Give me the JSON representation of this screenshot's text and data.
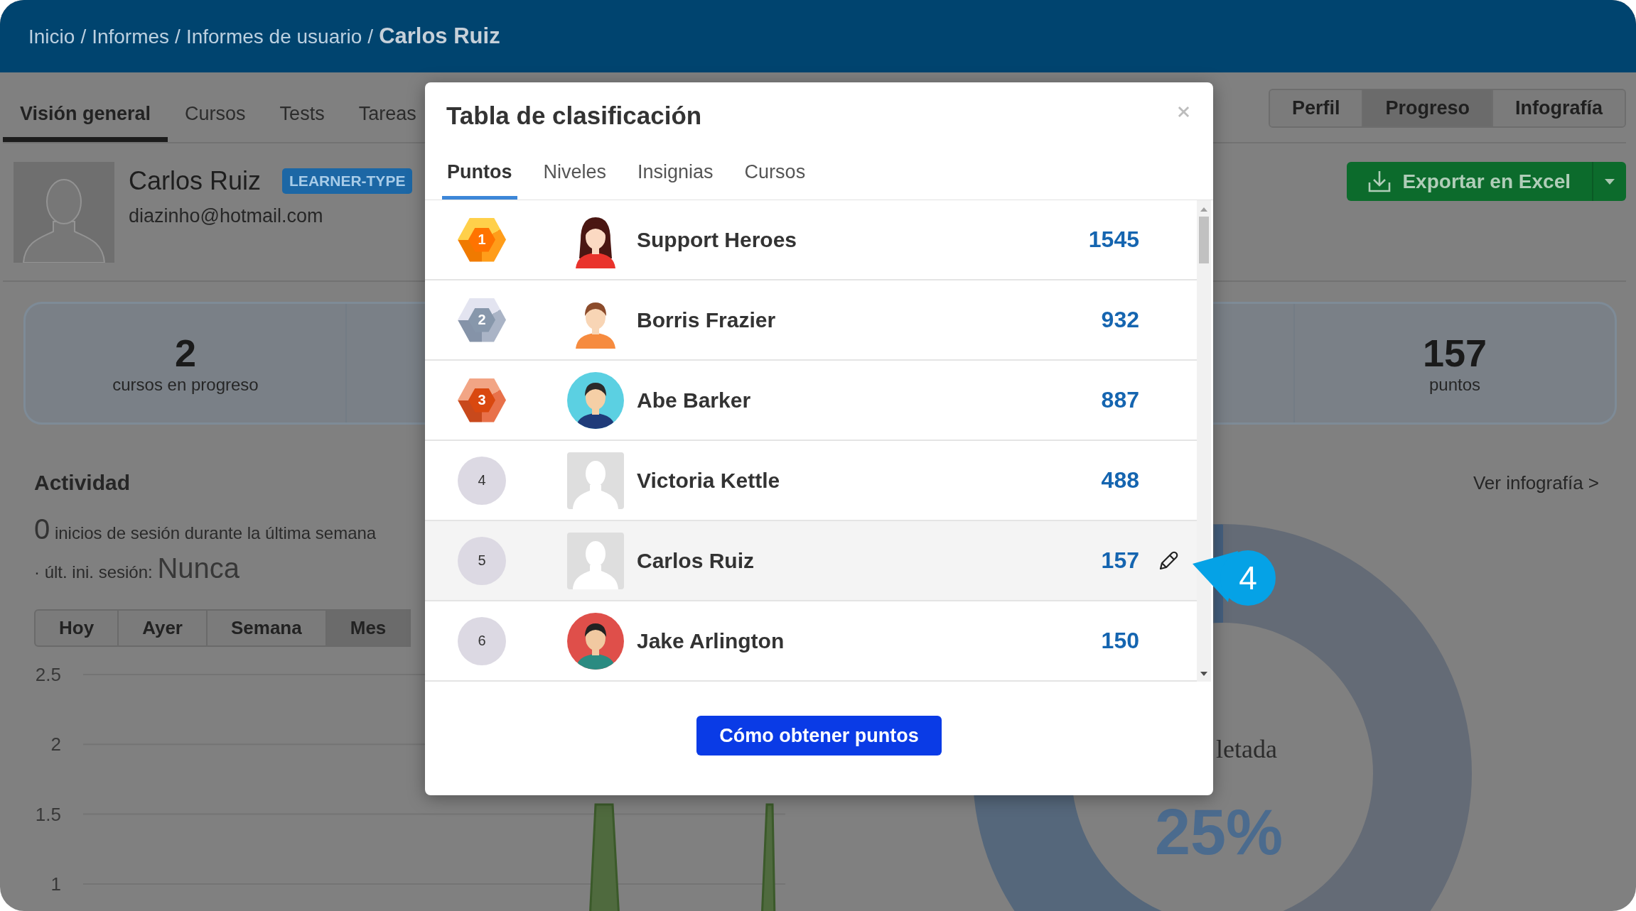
{
  "breadcrumb": {
    "items": [
      "Inicio",
      "Informes",
      "Informes de usuario"
    ],
    "separator": "/",
    "current": "Carlos Ruiz"
  },
  "nav_tabs": [
    {
      "label": "Visión general",
      "selected": true
    },
    {
      "label": "Cursos",
      "selected": false
    },
    {
      "label": "Tests",
      "selected": false
    },
    {
      "label": "Tareas",
      "selected": false
    }
  ],
  "view_switch": [
    {
      "label": "Perfil",
      "selected": false
    },
    {
      "label": "Progreso",
      "selected": true
    },
    {
      "label": "Infografía",
      "selected": false
    }
  ],
  "profile": {
    "name": "Carlos Ruiz",
    "badge": "LEARNER-TYPE",
    "email": "diazinho@hotmail.com"
  },
  "export_button": {
    "label": "Exportar en Excel"
  },
  "stats": [
    {
      "value": "2",
      "label": "cursos en progreso"
    },
    {
      "value": "157",
      "label": "puntos"
    }
  ],
  "activity": {
    "title": "Actividad",
    "logins_count": "0",
    "logins_text": "inicios de sesión durante la última semana",
    "last_login_label": "· últ. ini. sesión:",
    "last_login_value": "Nunca",
    "periods": [
      {
        "label": "Hoy",
        "selected": false
      },
      {
        "label": "Ayer",
        "selected": false
      },
      {
        "label": "Semana",
        "selected": false
      },
      {
        "label": "Mes",
        "selected": true
      }
    ],
    "chart": {
      "y_labels": [
        "2.5",
        "2",
        "1.5",
        "1"
      ]
    }
  },
  "infographic_link": "Ver infografía >",
  "completion": {
    "label": "letada",
    "value": "25%"
  },
  "leaderboard": {
    "title": "Tabla de clasificación",
    "tabs": [
      {
        "label": "Puntos",
        "selected": true
      },
      {
        "label": "Niveles",
        "selected": false
      },
      {
        "label": "Insignias",
        "selected": false
      },
      {
        "label": "Cursos",
        "selected": false
      }
    ],
    "rows": [
      {
        "rank": {
          "label": "1",
          "kind": "gold"
        },
        "avatar": {
          "kind": "illustration"
        },
        "name": "Support Heroes",
        "points": "1545",
        "current_user": false
      },
      {
        "rank": {
          "label": "2",
          "kind": "silver"
        },
        "avatar": {
          "kind": "illustration"
        },
        "name": "Borris Frazier",
        "points": "932",
        "current_user": false
      },
      {
        "rank": {
          "label": "3",
          "kind": "bronze"
        },
        "avatar": {
          "kind": "illustration"
        },
        "name": "Abe Barker",
        "points": "887",
        "current_user": false
      },
      {
        "rank": {
          "label": "4",
          "kind": "plain"
        },
        "avatar": {
          "kind": "placeholder"
        },
        "name": "Victoria Kettle",
        "points": "488",
        "current_user": false
      },
      {
        "rank": {
          "label": "5",
          "kind": "plain"
        },
        "avatar": {
          "kind": "placeholder"
        },
        "name": "Carlos Ruiz",
        "points": "157",
        "current_user": true
      },
      {
        "rank": {
          "label": "6",
          "kind": "plain"
        },
        "avatar": {
          "kind": "illustration"
        },
        "name": "Jake Arlington",
        "points": "150",
        "current_user": false
      }
    ],
    "button": "Cómo obtener puntos"
  },
  "callout": {
    "label": "4"
  }
}
